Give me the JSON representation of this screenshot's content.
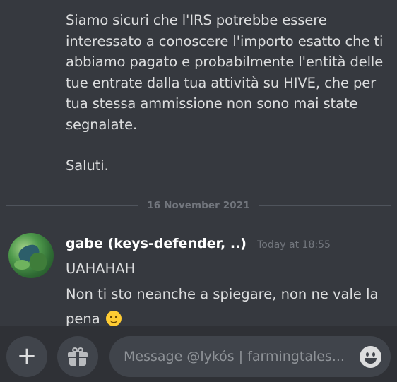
{
  "previous_message": {
    "lines": [
      "Siamo sicuri che l'IRS potrebbe essere",
      "interessato a conoscere l'importo esatto che ti",
      "abbiamo pagato e probabilmente l'entità delle",
      "tue entrate dalla tua attività su HIVE, che per",
      "tua stessa ammissione non sono mai state",
      "segnalate."
    ],
    "closing": "Saluti."
  },
  "date_divider": "16 November 2021",
  "message": {
    "username": "gabe (keys-defender, ..)",
    "timestamp": "Today at 18:55",
    "line1": "UAHAHAH",
    "line2": "Non ti sto neanche a spiegare, non ne vale la pena",
    "line2_emoji": "slightly-smiling-face"
  },
  "composer": {
    "placeholder": "Message @lykós | farmingtales..."
  },
  "colors": {
    "background": "#36393f",
    "composer_bar": "#2f3136",
    "input_bg": "#40444b"
  }
}
